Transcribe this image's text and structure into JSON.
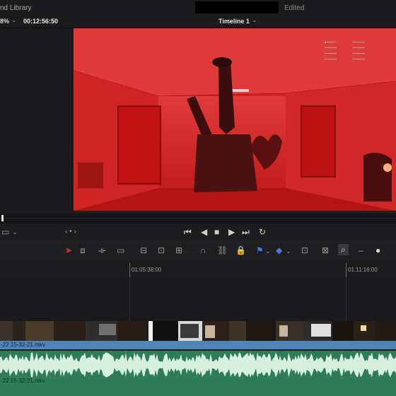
{
  "header": {
    "library_label": "nd Library",
    "status_label": "Edited"
  },
  "viewer_bar": {
    "zoom": "8%",
    "timecode": "00:12:56:50",
    "timeline_name": "Timeline 1"
  },
  "ruler": {
    "tc_a": "01:05:38:00",
    "tc_b": "01:11:16:00"
  },
  "clips": {
    "video_name": "-22 15-32-21.mkv",
    "audio_name": "-22 15-32-21.mkv"
  },
  "icons": {
    "accent": "#e53030",
    "flag": "#3b7de0"
  },
  "colors": {
    "video_track": "#4e85b8",
    "audio_track": "#2f7d57"
  }
}
